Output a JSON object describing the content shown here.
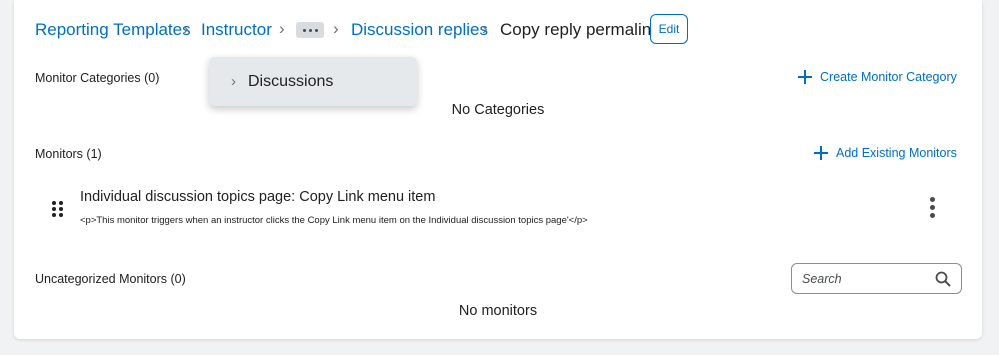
{
  "breadcrumb": {
    "items": [
      "Reporting Templates",
      "Instructor",
      "Discussion replies"
    ],
    "current": "Copy reply permalink",
    "edit_label": "Edit"
  },
  "dropdown": {
    "items": [
      "Discussions"
    ]
  },
  "monitor_categories": {
    "label": "Monitor Categories (0)",
    "action_label": "Create Monitor Category",
    "empty_message": "No Categories"
  },
  "monitors": {
    "label": "Monitors (1)",
    "action_label": "Add Existing Monitors",
    "items": [
      {
        "title": "Individual discussion topics page: Copy Link menu item",
        "description": "<p>This monitor triggers when an instructor clicks the Copy Link menu item on the Individual discussion topics page'</p>"
      }
    ]
  },
  "uncategorized": {
    "label": "Uncategorized Monitors (0)",
    "search_placeholder": "Search",
    "empty_message": "No monitors"
  },
  "colors": {
    "link": "#006fbf",
    "background": "#f1f2f4",
    "card": "#ffffff"
  }
}
